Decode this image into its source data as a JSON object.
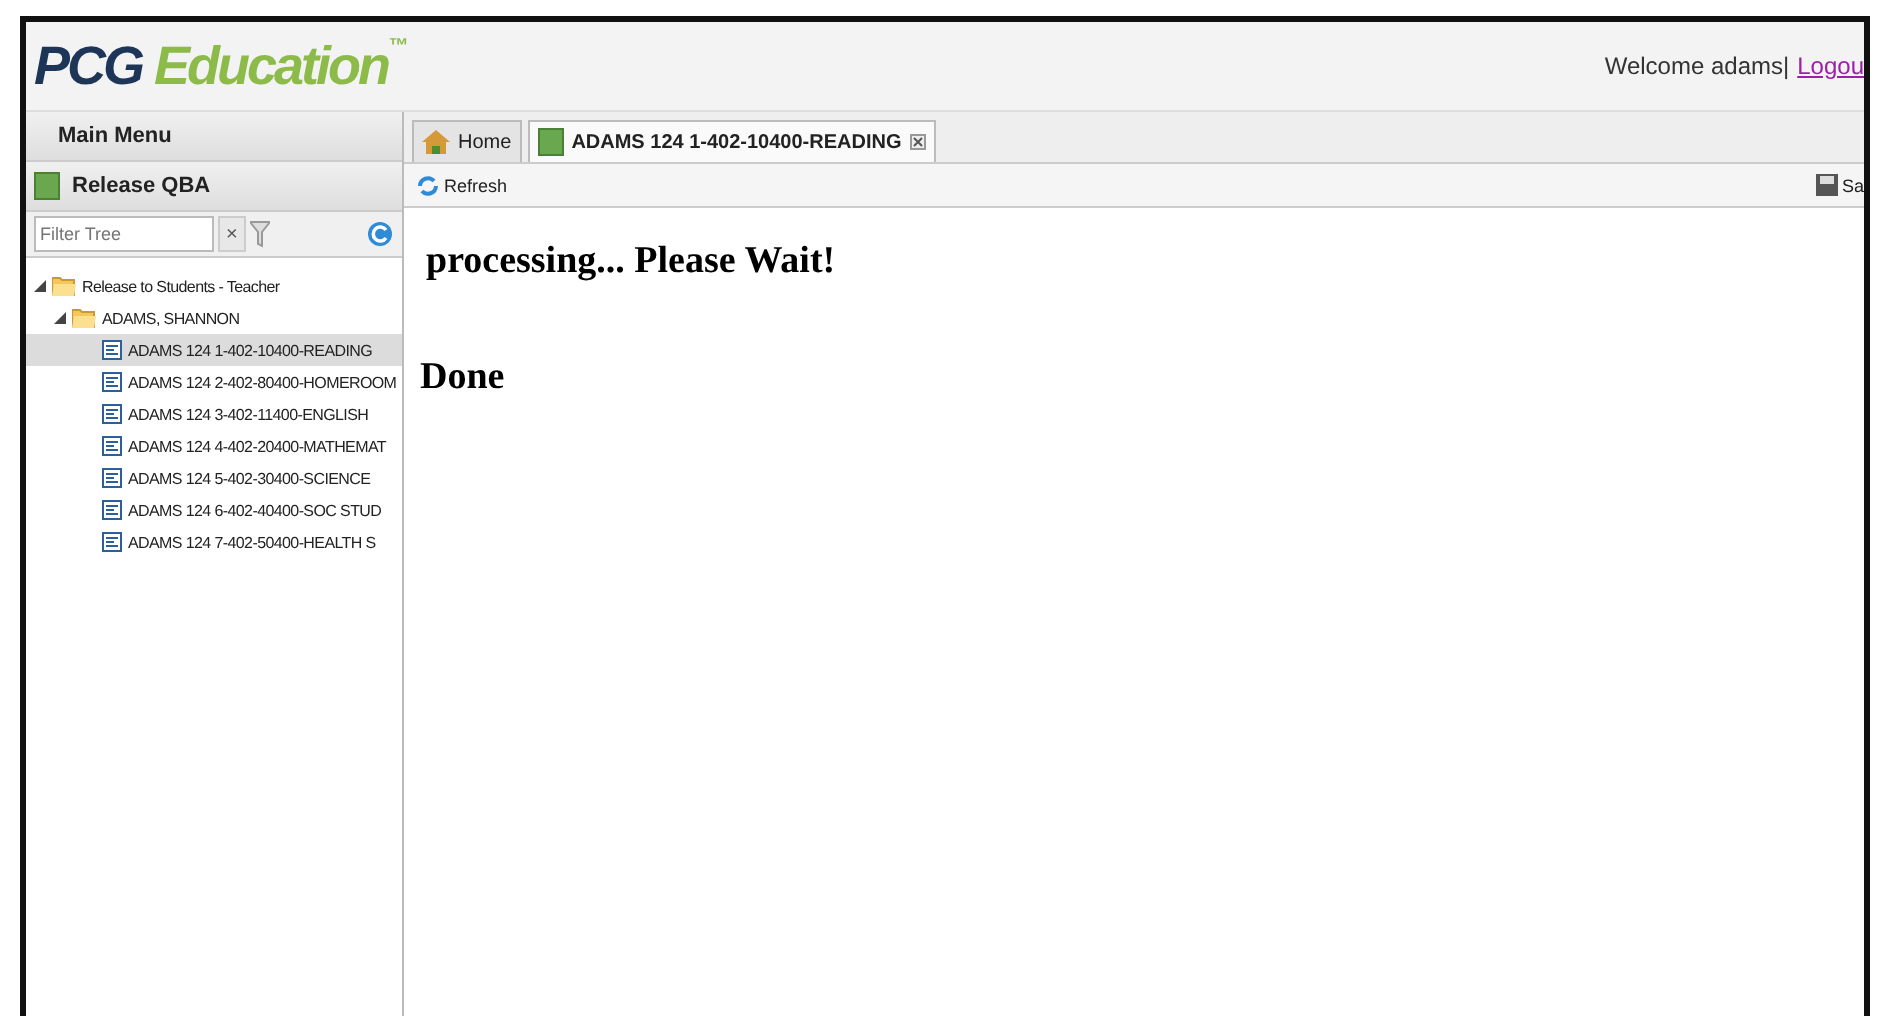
{
  "header": {
    "logo_main": "PCG",
    "logo_accent": "Education",
    "logo_mark": "™",
    "welcome": "Welcome adams|",
    "logout": "Logou"
  },
  "sidebar": {
    "main_menu": "Main Menu",
    "section": "Release QBA",
    "filter": {
      "placeholder": "Filter Tree",
      "clear": "×"
    },
    "tree": [
      {
        "label": "Release to Students - Teacher",
        "kind": "folder",
        "expanded": true,
        "selected": false,
        "children": [
          {
            "label": "ADAMS, SHANNON",
            "kind": "folder",
            "expanded": true,
            "selected": false,
            "children": [
              {
                "label": "ADAMS 124 1-402-10400-READING",
                "kind": "doc",
                "selected": true
              },
              {
                "label": "ADAMS 124 2-402-80400-HOMEROOM",
                "kind": "doc",
                "selected": false
              },
              {
                "label": "ADAMS 124 3-402-11400-ENGLISH",
                "kind": "doc",
                "selected": false
              },
              {
                "label": "ADAMS 124 4-402-20400-MATHEMAT",
                "kind": "doc",
                "selected": false
              },
              {
                "label": "ADAMS 124 5-402-30400-SCIENCE",
                "kind": "doc",
                "selected": false
              },
              {
                "label": "ADAMS 124 6-402-40400-SOC STUD",
                "kind": "doc",
                "selected": false
              },
              {
                "label": "ADAMS 124 7-402-50400-HEALTH S",
                "kind": "doc",
                "selected": false
              }
            ]
          }
        ]
      }
    ]
  },
  "tabs": [
    {
      "label": "Home",
      "kind": "home",
      "selected": false
    },
    {
      "label": "ADAMS 124 1-402-10400-READING",
      "kind": "doc",
      "selected": true
    }
  ],
  "toolbar": {
    "refresh": "Refresh",
    "save": "Sa"
  },
  "content": {
    "status": "processing... Please Wait!",
    "result": "Done"
  }
}
